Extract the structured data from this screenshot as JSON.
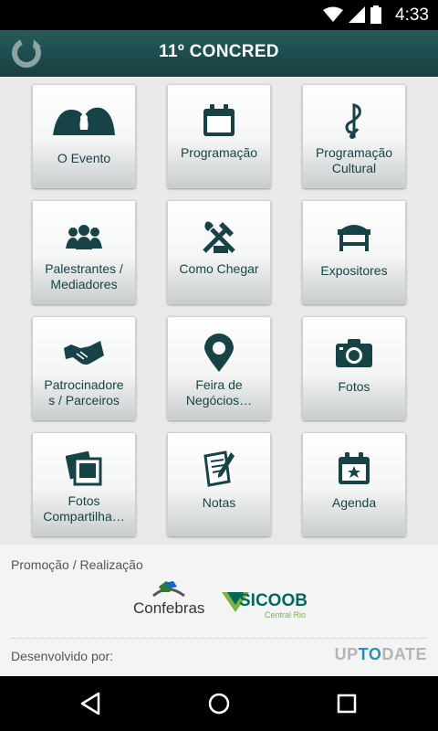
{
  "status": {
    "time": "4:33"
  },
  "appbar": {
    "title": "11º CONCRED",
    "refresh_icon": "refresh-icon"
  },
  "tiles": [
    {
      "label": "O Evento",
      "icon": "event-icon"
    },
    {
      "label": "Programação",
      "icon": "calendar-icon"
    },
    {
      "label": "Programação\nCultural",
      "icon": "music-note-icon"
    },
    {
      "label": "Palestrantes /\nMediadores",
      "icon": "people-icon"
    },
    {
      "label": "Como Chegar",
      "icon": "tools-icon"
    },
    {
      "label": "Expositores",
      "icon": "booth-icon"
    },
    {
      "label": "Patrocinadore\ns / Parceiros",
      "icon": "handshake-icon"
    },
    {
      "label": "Feira de\nNegócios…",
      "icon": "map-pin-icon"
    },
    {
      "label": "Fotos",
      "icon": "camera-icon"
    },
    {
      "label": "Fotos\nCompartilha…",
      "icon": "photos-icon"
    },
    {
      "label": "Notas",
      "icon": "notes-icon"
    },
    {
      "label": "Agenda",
      "icon": "agenda-icon"
    }
  ],
  "footer": {
    "promo": "Promoção / Realização",
    "confebras": "Confebras",
    "sicoob": "SICOOB",
    "sicoob_sub": "Central Rio",
    "dev": "Desenvolvido por:",
    "brand_a": "UP",
    "brand_b": "TO",
    "brand_c": "DATE"
  },
  "colors": {
    "appbar": "#1e4a4d",
    "tile_text": "#174346",
    "icon": "#174346"
  }
}
